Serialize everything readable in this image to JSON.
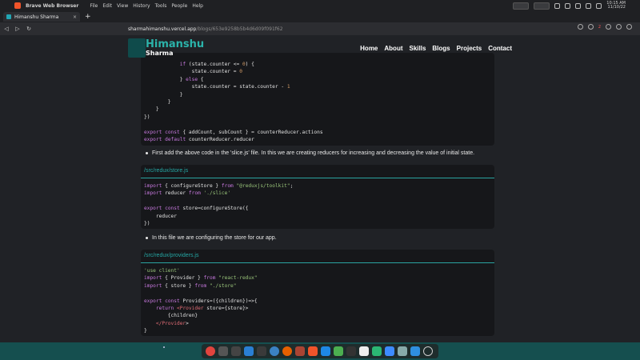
{
  "system_bar": {
    "app_name": "Brave Web Browser",
    "menus": [
      "File",
      "Edit",
      "View",
      "History",
      "Tools",
      "People",
      "Help"
    ],
    "time": "10:15 AM",
    "date": "11/10/22"
  },
  "tab": {
    "title": "Himanshu Sharma",
    "close": "×",
    "new_tab": "+"
  },
  "urlbar": {
    "back": "◁",
    "forward": "▷",
    "reload": "↻",
    "host": "sharmahimanshu.vercel.app",
    "path": "/blogs/653e9258b5b4d6d09f091f62",
    "shield_count": "2"
  },
  "site": {
    "logo_title": "Himanshu",
    "logo_subtitle": "Sharma",
    "nav": [
      "Home",
      "About",
      "Skills",
      "Blogs",
      "Projects",
      "Contact"
    ]
  },
  "code_block_1": [
    "            if (state.counter <= 0) {",
    "                state.counter = 0",
    "            } else {",
    "                state.counter = state.counter - 1",
    "            }",
    "        }",
    "    }",
    "})",
    "",
    "export const { addCount, subCount } = counterReducer.actions",
    "export default counterReducer.reducer"
  ],
  "bullet_1": "First add the above code in the 'slice.js' file. In this we are creating reducers for increasing and decreasing the value of initial state.",
  "store_file": {
    "name": "/src/redux/store.js",
    "lines": [
      "import { configureStore } from \"@reduxjs/toolkit\";",
      "import reducer from './slice'",
      "",
      "export const store=configureStore({",
      "    reducer",
      "})"
    ]
  },
  "bullet_2": "In this file we are configuring the store for our app.",
  "providers_file": {
    "name": "/src/redux/providers.js",
    "lines": [
      "'use client'",
      "import { Provider } from \"react-redux\"",
      "import { store } from \"./store\"",
      "",
      "export const Providers=({children})=>{",
      "    return <Provider store={store}>",
      "        {children}",
      "    </Provider>",
      "}"
    ]
  },
  "colors": {
    "accent": "#2bb3aa",
    "page_bg": "#202226",
    "code_bg": "#16171a"
  }
}
